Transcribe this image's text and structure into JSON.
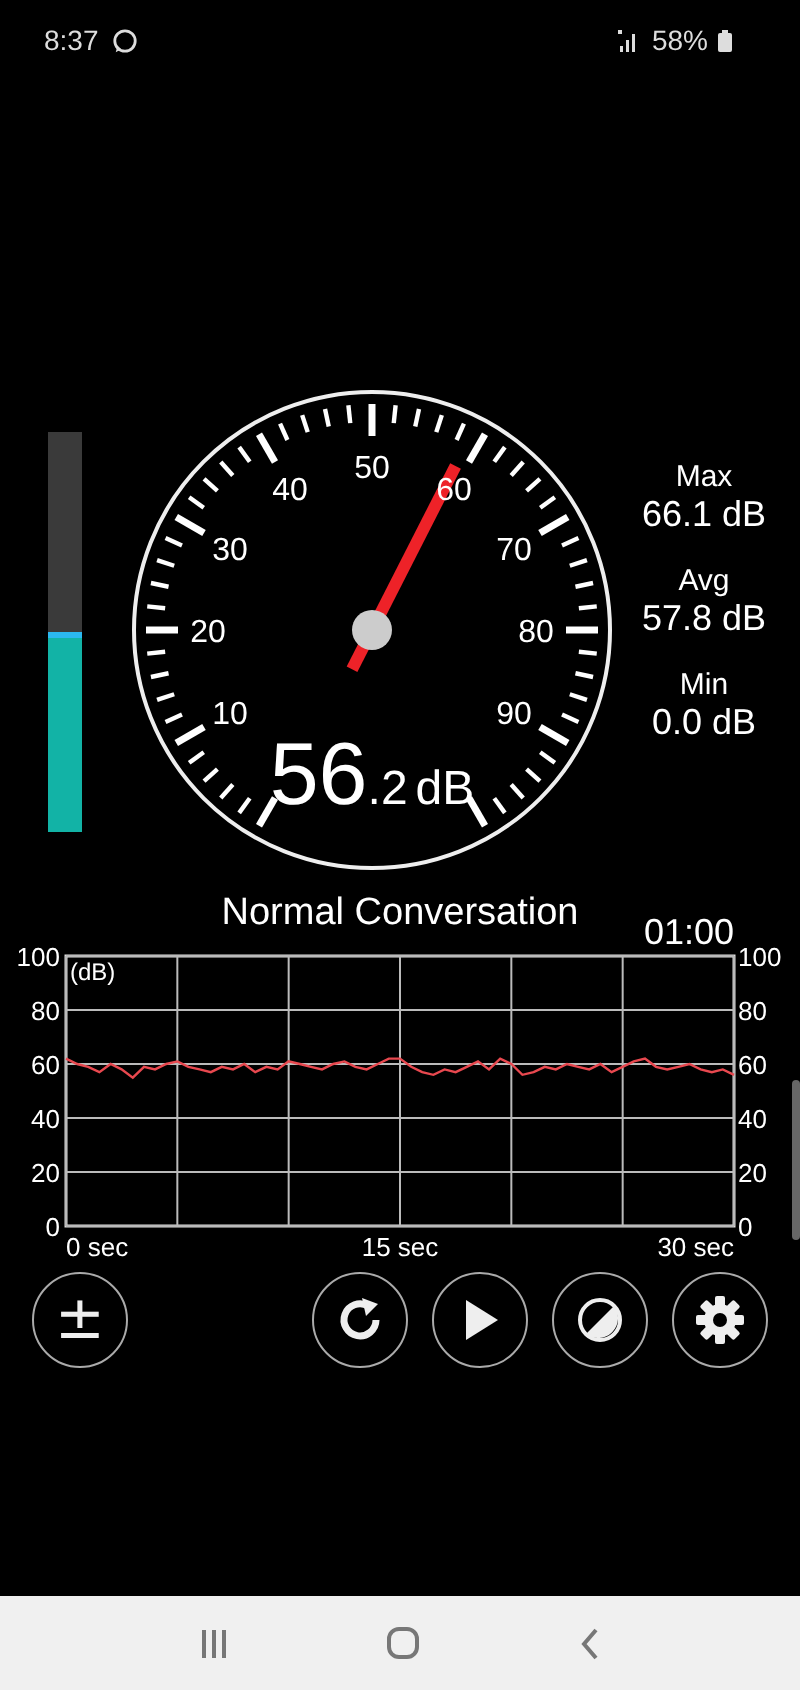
{
  "status_bar": {
    "time": "8:37",
    "battery": "58%"
  },
  "meter": {
    "level": 0.5
  },
  "gauge": {
    "dial_labels": [
      "10",
      "20",
      "30",
      "40",
      "50",
      "60",
      "70",
      "80",
      "90"
    ],
    "reading": {
      "whole": "56",
      "decimal": ".2",
      "unit": "dB"
    }
  },
  "stats": [
    {
      "label": "Max",
      "value": "66.1 dB"
    },
    {
      "label": "Avg",
      "value": "57.8 dB"
    },
    {
      "label": "Min",
      "value": "0.0 dB"
    }
  ],
  "status_text": "Normal Conversation",
  "timer": "01:00",
  "history": {
    "right_axis_labels": [
      "100",
      "80",
      "60",
      "40",
      "20",
      "0"
    ],
    "x_axis_labels": [
      "0 sec",
      "15 sec",
      "30 sec"
    ],
    "chart_data": {
      "type": "line",
      "ylabel": "(dB)",
      "ylim": [
        0,
        100
      ],
      "grid": true,
      "yticks": [
        100,
        80,
        60,
        40,
        20,
        0
      ],
      "series": [
        {
          "color": "#e8484f",
          "values": [
            62,
            60,
            59,
            57,
            60,
            58,
            55,
            59,
            58,
            60,
            61,
            59,
            58,
            57,
            59,
            58,
            60,
            57,
            59,
            58,
            61,
            60,
            59,
            58,
            60,
            61,
            59,
            58,
            60,
            62,
            62,
            59,
            57,
            56,
            58,
            57,
            59,
            61,
            58,
            62,
            60,
            56,
            57,
            59,
            58,
            60,
            59,
            58,
            60,
            57,
            59,
            61,
            62,
            59,
            58,
            59,
            60,
            58,
            57,
            58,
            56
          ]
        }
      ]
    }
  },
  "controls": [
    {
      "kind": "calibrate",
      "label": "±"
    },
    {
      "kind": "reset"
    },
    {
      "kind": "play"
    },
    {
      "kind": "theme"
    },
    {
      "kind": "settings"
    }
  ]
}
